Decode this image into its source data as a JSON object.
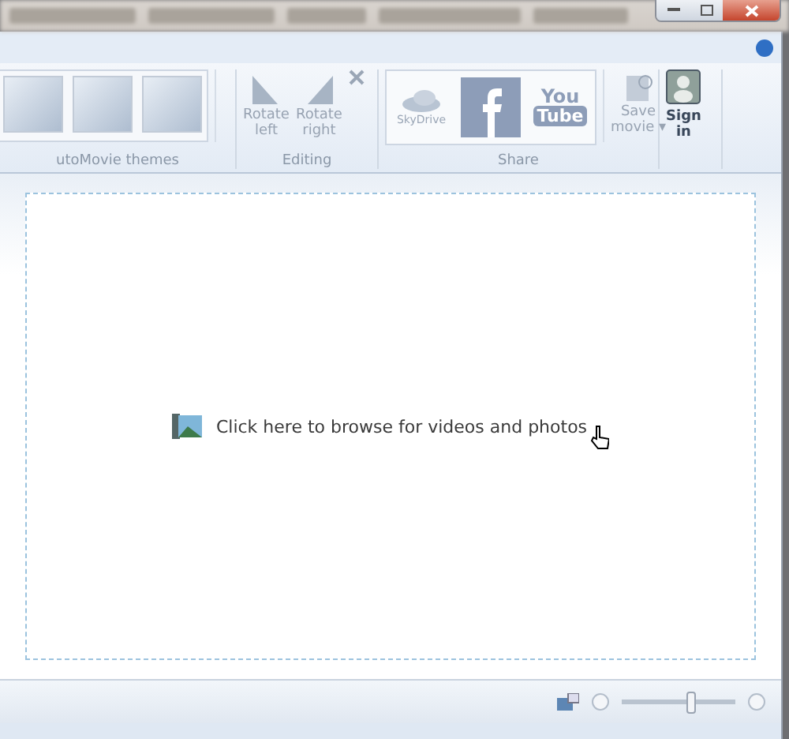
{
  "ribbon": {
    "groups": [
      {
        "kind": "themes",
        "label": "utoMovie themes"
      },
      {
        "kind": "editing",
        "label": "Editing",
        "buttons": [
          "Rotate\nleft",
          "Rotate\nright"
        ]
      },
      {
        "kind": "share",
        "label": "Share",
        "skydrive": "SkyDrive",
        "youtube_top": "You",
        "youtube_bottom": "Tube",
        "save": "Save\nmovie ▾"
      },
      {
        "kind": "signin",
        "label": "Sign\nin"
      }
    ]
  },
  "content": {
    "prompt": "Click here to browse for videos and photos"
  },
  "status_bar": {
    "zoom": {
      "level": 0.62
    }
  }
}
